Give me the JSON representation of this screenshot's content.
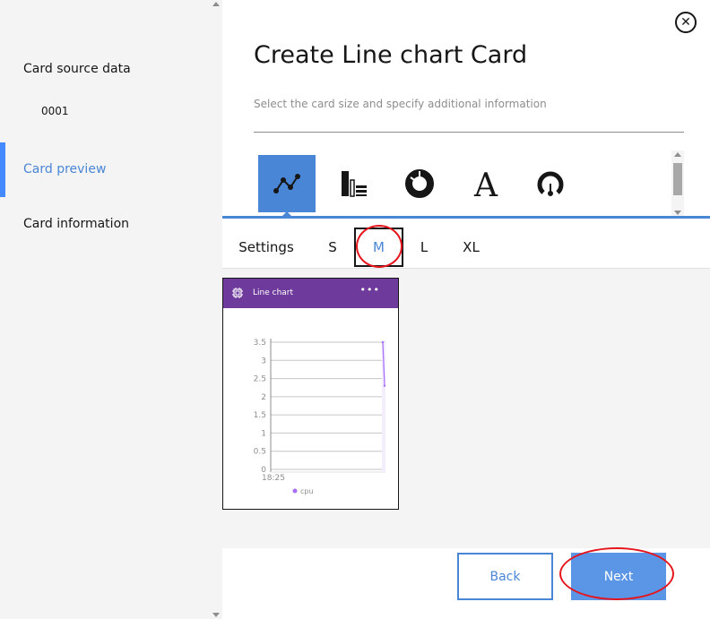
{
  "sidebar": {
    "items": [
      {
        "label": "Card source data"
      },
      {
        "label": "0001"
      },
      {
        "label": "Card preview"
      },
      {
        "label": "Card information"
      }
    ]
  },
  "header": {
    "title": "Create Line chart Card",
    "subtitle": "Select the card size and specify additional information"
  },
  "chart_type_icons": [
    "line-chart-icon",
    "bar-chart-icon",
    "donut-chart-icon",
    "text-icon",
    "gauge-icon"
  ],
  "tabs": [
    {
      "label": "Settings"
    },
    {
      "label": "S"
    },
    {
      "label": "M"
    },
    {
      "label": "L"
    },
    {
      "label": "XL"
    }
  ],
  "card": {
    "title": "Line chart",
    "more": "•••"
  },
  "chart_data": {
    "type": "line",
    "series": [
      {
        "name": "cpu",
        "x": [
          0,
          1
        ],
        "values": [
          3.5,
          2.3
        ]
      }
    ],
    "x_tick_labels": [
      "18:25"
    ],
    "y_tick_labels": [
      "3.5",
      "3",
      "2.5",
      "2",
      "1.5",
      "1",
      "0.5",
      "0"
    ],
    "ylim": [
      0,
      3.5
    ],
    "legend": "bottom",
    "color": "#a66efa"
  },
  "footer": {
    "back_label": "Back",
    "next_label": "Next"
  },
  "colors": {
    "accent": "#4a86d6",
    "card_header": "#6e3b9c"
  }
}
